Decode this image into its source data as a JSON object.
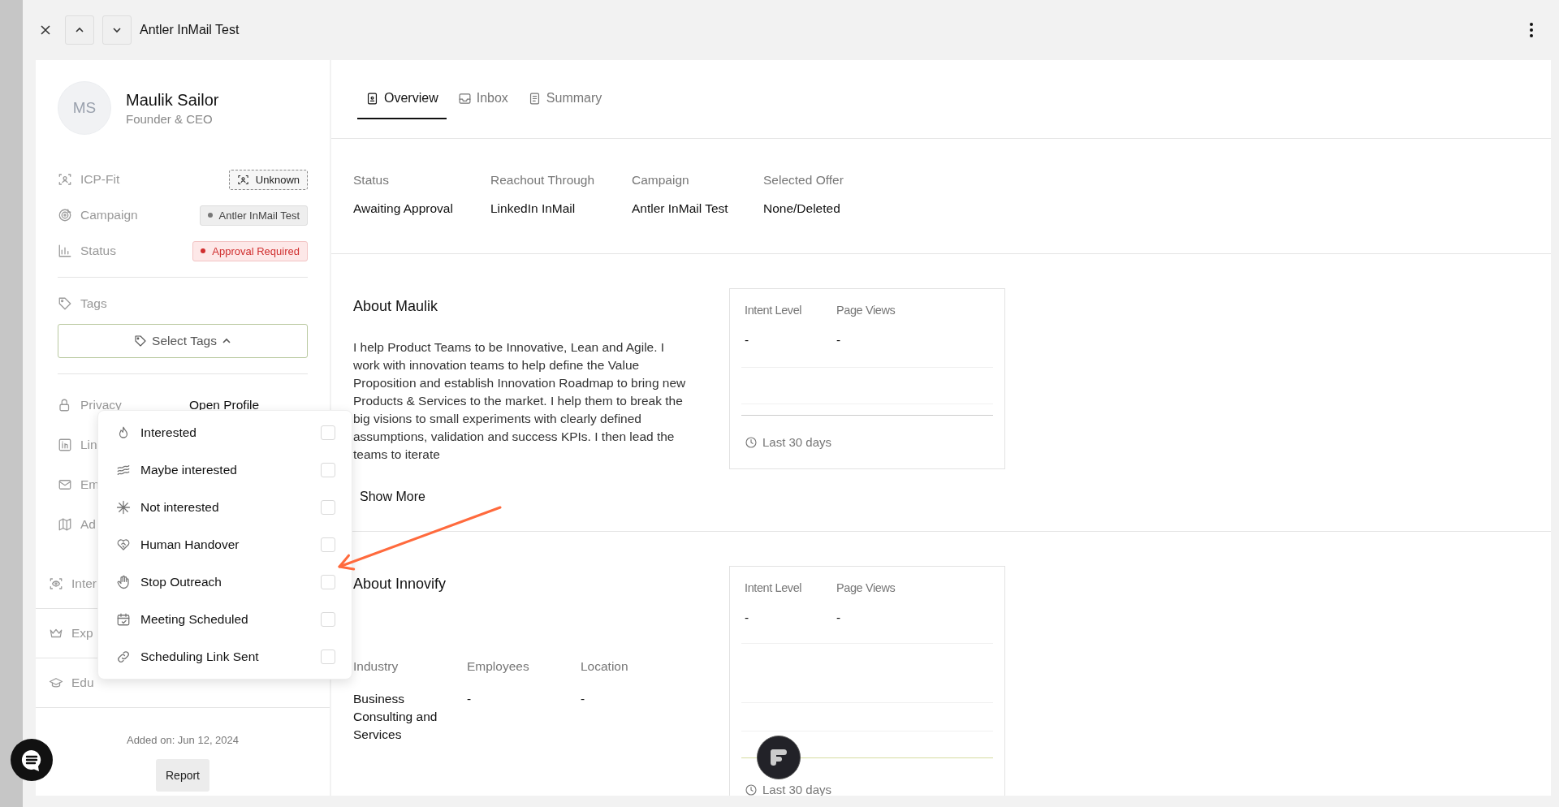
{
  "header": {
    "title": "Antler InMail Test"
  },
  "profile": {
    "initials": "MS",
    "name": "Maulik Sailor",
    "title": "Founder & CEO"
  },
  "attributes": [
    {
      "kind": "icp",
      "label": "ICP-Fit",
      "value": "Unknown"
    },
    {
      "kind": "campaign",
      "label": "Campaign",
      "value": "Antler InMail Test"
    },
    {
      "kind": "status",
      "label": "Status",
      "value": "Approval Required"
    }
  ],
  "tags": {
    "label": "Tags",
    "button": "Select Tags",
    "expanded": true,
    "options": [
      {
        "kind": "flame",
        "label": "Interested",
        "checked": false
      },
      {
        "kind": "waves",
        "label": "Maybe interested",
        "checked": false
      },
      {
        "kind": "snowflake",
        "label": "Not interested",
        "checked": false
      },
      {
        "kind": "heart",
        "label": "Human Handover",
        "checked": false
      },
      {
        "kind": "hand",
        "label": "Stop Outreach",
        "checked": false
      },
      {
        "kind": "calendar",
        "label": "Meeting Scheduled",
        "checked": false
      },
      {
        "kind": "link",
        "label": "Scheduling Link Sent",
        "checked": false
      }
    ]
  },
  "details": [
    {
      "kind": "privacy",
      "label": "Privacy",
      "value": "Open Profile"
    },
    {
      "kind": "linkedin",
      "label": "Lin"
    },
    {
      "kind": "email",
      "label": "Em"
    },
    {
      "kind": "address",
      "label": "Ad"
    }
  ],
  "sections": [
    {
      "kind": "interests",
      "label": "Inter"
    },
    {
      "kind": "experience",
      "label": "Exp"
    },
    {
      "kind": "education",
      "label": "Edu"
    }
  ],
  "added_on": "Added on: Jun 12, 2024",
  "report_button": "Report",
  "tabs": [
    {
      "kind": "overview",
      "label": "Overview",
      "selected": true
    },
    {
      "kind": "inbox",
      "label": "Inbox",
      "selected": false
    },
    {
      "kind": "summary",
      "label": "Summary",
      "selected": false
    }
  ],
  "overview_fields": [
    {
      "label": "Status",
      "value": "Awaiting Approval"
    },
    {
      "label": "Reachout Through",
      "value": "LinkedIn InMail"
    },
    {
      "label": "Campaign",
      "value": "Antler InMail Test"
    },
    {
      "label": "Selected Offer",
      "value": "None/Deleted"
    }
  ],
  "about_person": {
    "heading": "About Maulik",
    "text": "I help Product Teams to be Innovative, Lean and Agile. I work with innovation teams to help define the Value Proposition and establish Innovation Roadmap to bring new Products & Services to the market. I help them to break the big visions to small experiments with clearly defined assumptions, validation and success KPIs. I then lead the teams to iterate",
    "show_more": "Show More",
    "stats": {
      "columns": [
        {
          "label": "Intent Level",
          "value": "-"
        },
        {
          "label": "Page Views",
          "value": "-"
        }
      ],
      "period": "Last 30 days"
    }
  },
  "about_company": {
    "heading": "About Innovify",
    "fields": [
      {
        "label": "Industry",
        "value": "Business Consulting and Services"
      },
      {
        "label": "Employees",
        "value": "-"
      },
      {
        "label": "Location",
        "value": "-"
      }
    ],
    "stats": {
      "columns": [
        {
          "label": "Intent Level",
          "value": "-"
        },
        {
          "label": "Page Views",
          "value": "-"
        }
      ],
      "period": "Last 30 days"
    }
  }
}
